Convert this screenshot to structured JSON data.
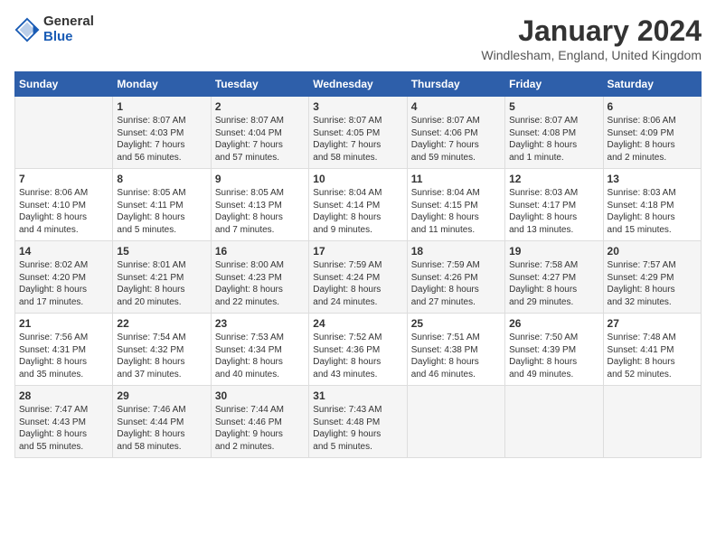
{
  "logo": {
    "general": "General",
    "blue": "Blue"
  },
  "header": {
    "month_year": "January 2024",
    "location": "Windlesham, England, United Kingdom"
  },
  "days": [
    "Sunday",
    "Monday",
    "Tuesday",
    "Wednesday",
    "Thursday",
    "Friday",
    "Saturday"
  ],
  "weeks": [
    [
      {
        "day": "",
        "content": ""
      },
      {
        "day": "1",
        "content": "Sunrise: 8:07 AM\nSunset: 4:03 PM\nDaylight: 7 hours\nand 56 minutes."
      },
      {
        "day": "2",
        "content": "Sunrise: 8:07 AM\nSunset: 4:04 PM\nDaylight: 7 hours\nand 57 minutes."
      },
      {
        "day": "3",
        "content": "Sunrise: 8:07 AM\nSunset: 4:05 PM\nDaylight: 7 hours\nand 58 minutes."
      },
      {
        "day": "4",
        "content": "Sunrise: 8:07 AM\nSunset: 4:06 PM\nDaylight: 7 hours\nand 59 minutes."
      },
      {
        "day": "5",
        "content": "Sunrise: 8:07 AM\nSunset: 4:08 PM\nDaylight: 8 hours\nand 1 minute."
      },
      {
        "day": "6",
        "content": "Sunrise: 8:06 AM\nSunset: 4:09 PM\nDaylight: 8 hours\nand 2 minutes."
      }
    ],
    [
      {
        "day": "7",
        "content": "Sunrise: 8:06 AM\nSunset: 4:10 PM\nDaylight: 8 hours\nand 4 minutes."
      },
      {
        "day": "8",
        "content": "Sunrise: 8:05 AM\nSunset: 4:11 PM\nDaylight: 8 hours\nand 5 minutes."
      },
      {
        "day": "9",
        "content": "Sunrise: 8:05 AM\nSunset: 4:13 PM\nDaylight: 8 hours\nand 7 minutes."
      },
      {
        "day": "10",
        "content": "Sunrise: 8:04 AM\nSunset: 4:14 PM\nDaylight: 8 hours\nand 9 minutes."
      },
      {
        "day": "11",
        "content": "Sunrise: 8:04 AM\nSunset: 4:15 PM\nDaylight: 8 hours\nand 11 minutes."
      },
      {
        "day": "12",
        "content": "Sunrise: 8:03 AM\nSunset: 4:17 PM\nDaylight: 8 hours\nand 13 minutes."
      },
      {
        "day": "13",
        "content": "Sunrise: 8:03 AM\nSunset: 4:18 PM\nDaylight: 8 hours\nand 15 minutes."
      }
    ],
    [
      {
        "day": "14",
        "content": "Sunrise: 8:02 AM\nSunset: 4:20 PM\nDaylight: 8 hours\nand 17 minutes."
      },
      {
        "day": "15",
        "content": "Sunrise: 8:01 AM\nSunset: 4:21 PM\nDaylight: 8 hours\nand 20 minutes."
      },
      {
        "day": "16",
        "content": "Sunrise: 8:00 AM\nSunset: 4:23 PM\nDaylight: 8 hours\nand 22 minutes."
      },
      {
        "day": "17",
        "content": "Sunrise: 7:59 AM\nSunset: 4:24 PM\nDaylight: 8 hours\nand 24 minutes."
      },
      {
        "day": "18",
        "content": "Sunrise: 7:59 AM\nSunset: 4:26 PM\nDaylight: 8 hours\nand 27 minutes."
      },
      {
        "day": "19",
        "content": "Sunrise: 7:58 AM\nSunset: 4:27 PM\nDaylight: 8 hours\nand 29 minutes."
      },
      {
        "day": "20",
        "content": "Sunrise: 7:57 AM\nSunset: 4:29 PM\nDaylight: 8 hours\nand 32 minutes."
      }
    ],
    [
      {
        "day": "21",
        "content": "Sunrise: 7:56 AM\nSunset: 4:31 PM\nDaylight: 8 hours\nand 35 minutes."
      },
      {
        "day": "22",
        "content": "Sunrise: 7:54 AM\nSunset: 4:32 PM\nDaylight: 8 hours\nand 37 minutes."
      },
      {
        "day": "23",
        "content": "Sunrise: 7:53 AM\nSunset: 4:34 PM\nDaylight: 8 hours\nand 40 minutes."
      },
      {
        "day": "24",
        "content": "Sunrise: 7:52 AM\nSunset: 4:36 PM\nDaylight: 8 hours\nand 43 minutes."
      },
      {
        "day": "25",
        "content": "Sunrise: 7:51 AM\nSunset: 4:38 PM\nDaylight: 8 hours\nand 46 minutes."
      },
      {
        "day": "26",
        "content": "Sunrise: 7:50 AM\nSunset: 4:39 PM\nDaylight: 8 hours\nand 49 minutes."
      },
      {
        "day": "27",
        "content": "Sunrise: 7:48 AM\nSunset: 4:41 PM\nDaylight: 8 hours\nand 52 minutes."
      }
    ],
    [
      {
        "day": "28",
        "content": "Sunrise: 7:47 AM\nSunset: 4:43 PM\nDaylight: 8 hours\nand 55 minutes."
      },
      {
        "day": "29",
        "content": "Sunrise: 7:46 AM\nSunset: 4:44 PM\nDaylight: 8 hours\nand 58 minutes."
      },
      {
        "day": "30",
        "content": "Sunrise: 7:44 AM\nSunset: 4:46 PM\nDaylight: 9 hours\nand 2 minutes."
      },
      {
        "day": "31",
        "content": "Sunrise: 7:43 AM\nSunset: 4:48 PM\nDaylight: 9 hours\nand 5 minutes."
      },
      {
        "day": "",
        "content": ""
      },
      {
        "day": "",
        "content": ""
      },
      {
        "day": "",
        "content": ""
      }
    ]
  ]
}
